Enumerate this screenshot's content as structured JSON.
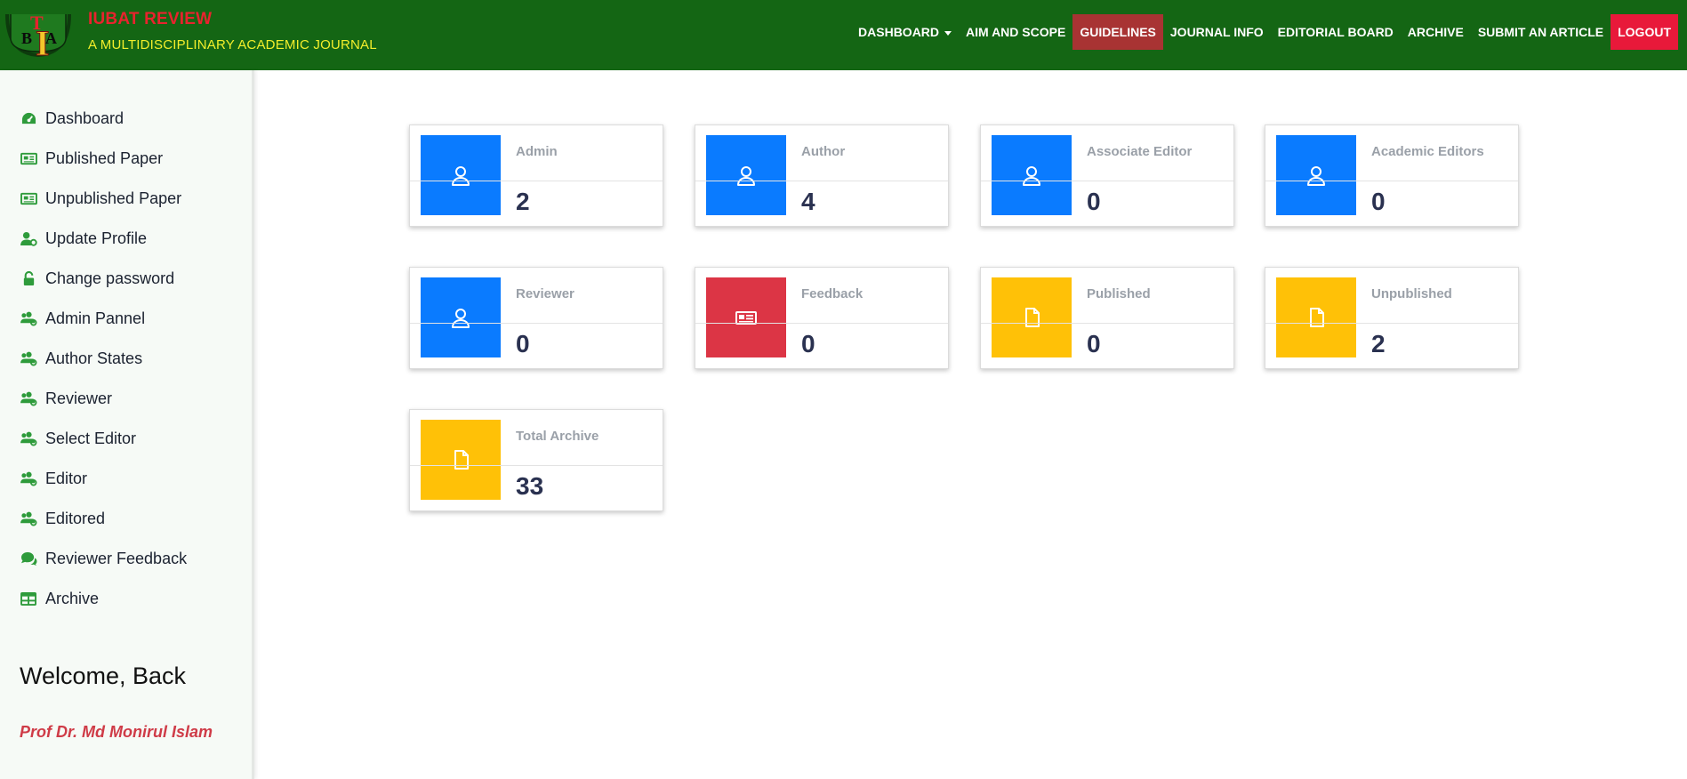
{
  "header": {
    "logo_letters": [
      "I",
      "B",
      "A",
      "T"
    ],
    "title": "IUBAT REVIEW",
    "subtitle": "A MULTIDISCIPLINARY ACADEMIC JOURNAL",
    "nav": [
      {
        "label": "DASHBOARD",
        "dropdown": true
      },
      {
        "label": "AIM AND SCOPE"
      },
      {
        "label": "GUIDELINES",
        "active": true
      },
      {
        "label": "JOURNAL INFO"
      },
      {
        "label": "EDITORIAL BOARD"
      },
      {
        "label": "ARCHIVE"
      },
      {
        "label": "SUBMIT AN ARTICLE"
      },
      {
        "label": "LOGOUT",
        "logout": true
      }
    ]
  },
  "sidebar": {
    "items": [
      {
        "label": "Dashboard",
        "icon": "gauge-icon"
      },
      {
        "label": "Published Paper",
        "icon": "newspaper-icon"
      },
      {
        "label": "Unpublished Paper",
        "icon": "newspaper-icon"
      },
      {
        "label": "Update Profile",
        "icon": "user-cog-icon"
      },
      {
        "label": "Change password",
        "icon": "unlock-icon"
      },
      {
        "label": "Admin Pannel",
        "icon": "users-cog-icon"
      },
      {
        "label": "Author States",
        "icon": "users-cog-icon"
      },
      {
        "label": "Reviewer",
        "icon": "users-cog-icon"
      },
      {
        "label": "Select Editor",
        "icon": "users-cog-icon"
      },
      {
        "label": "Editor",
        "icon": "users-cog-icon"
      },
      {
        "label": "Editored",
        "icon": "users-cog-icon"
      },
      {
        "label": "Reviewer Feedback",
        "icon": "comments-icon"
      },
      {
        "label": "Archive",
        "icon": "table-icon"
      }
    ],
    "welcome": "Welcome, Back",
    "user_name": "Prof Dr. Md Monirul Islam"
  },
  "cards": [
    {
      "label": "Admin",
      "value": "2",
      "icon": "user-icon",
      "color": "#0a7bff"
    },
    {
      "label": "Author",
      "value": "4",
      "icon": "user-icon",
      "color": "#0a7bff"
    },
    {
      "label": "Associate Editor",
      "value": "0",
      "icon": "user-icon",
      "color": "#0a7bff"
    },
    {
      "label": "Academic Editors",
      "value": "0",
      "icon": "user-icon",
      "color": "#0a7bff"
    },
    {
      "label": "Reviewer",
      "value": "0",
      "icon": "user-icon",
      "color": "#0a7bff"
    },
    {
      "label": "Feedback",
      "value": "0",
      "icon": "newspaper-icon",
      "color": "#dc3545"
    },
    {
      "label": "Published",
      "value": "0",
      "icon": "file-icon",
      "color": "#ffc107"
    },
    {
      "label": "Unpublished",
      "value": "2",
      "icon": "file-icon",
      "color": "#ffc107"
    },
    {
      "label": "Total Archive",
      "value": "33",
      "icon": "file-icon",
      "color": "#ffc107"
    }
  ],
  "colors": {
    "header_bg": "#146614",
    "sidebar_icon": "#2e9b3b",
    "active_nav": "#a83333",
    "logout": "#e8193a"
  }
}
